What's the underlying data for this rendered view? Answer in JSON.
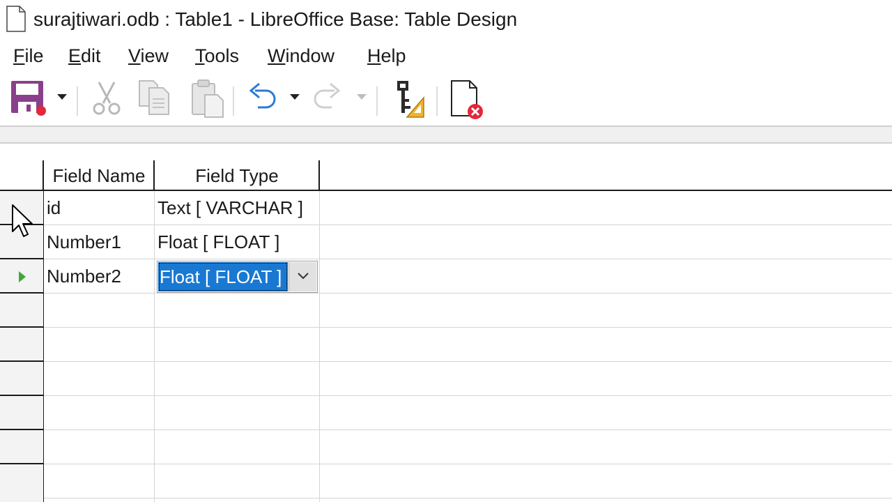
{
  "window": {
    "title": "surajtiwari.odb : Table1 - LibreOffice Base: Table Design"
  },
  "menu": [
    {
      "label_acc": "F",
      "label_rest": "ile"
    },
    {
      "label_acc": "E",
      "label_rest": "dit"
    },
    {
      "label_acc": "V",
      "label_rest": "iew"
    },
    {
      "label_acc": "T",
      "label_rest": "ools"
    },
    {
      "label_acc": "W",
      "label_rest": "indow"
    },
    {
      "label_acc": "H",
      "label_rest": "elp"
    }
  ],
  "toolbar": {
    "icons": [
      "save-icon",
      "cut-icon",
      "copy-icon",
      "paste-icon",
      "undo-icon",
      "redo-icon",
      "primary-key-icon",
      "close-document-icon"
    ]
  },
  "table": {
    "headers": {
      "field_name": "Field Name",
      "field_type": "Field Type"
    },
    "rows": [
      {
        "field_name": "id",
        "field_type": "Text [ VARCHAR ]"
      },
      {
        "field_name": "Number1",
        "field_type": "Float [ FLOAT ]"
      },
      {
        "field_name": "Number2",
        "field_type": "Float [ FLOAT ]"
      }
    ],
    "current_row_index": 2
  },
  "colors": {
    "selection": "#1979d2",
    "save_purple": "#8a3f8c",
    "current_row_marker": "#3fa83a",
    "undo_blue": "#2a7ad5"
  }
}
